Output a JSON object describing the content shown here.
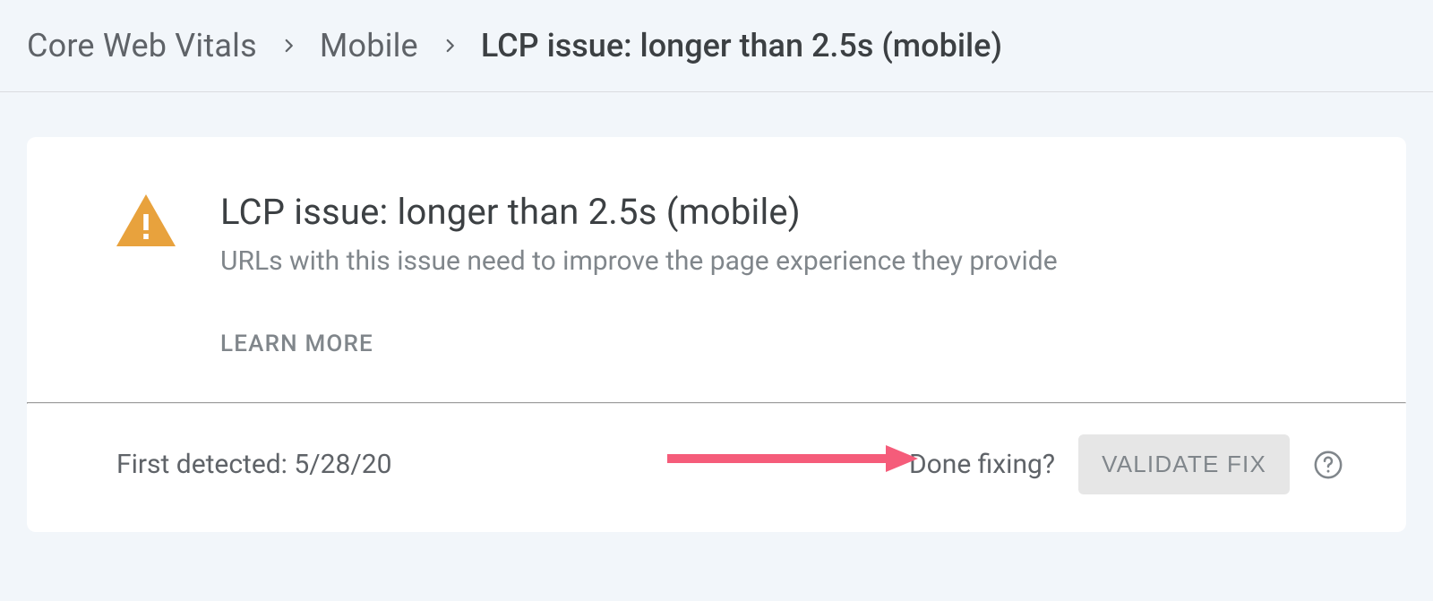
{
  "breadcrumb": {
    "items": [
      {
        "label": "Core Web Vitals",
        "current": false
      },
      {
        "label": "Mobile",
        "current": false
      },
      {
        "label": "LCP issue: longer than 2.5s (mobile)",
        "current": true
      }
    ]
  },
  "card": {
    "title": "LCP issue: longer than 2.5s (mobile)",
    "subtitle": "URLs with this issue need to improve the page experience they provide",
    "learn_more_label": "LEARN MORE",
    "warning_icon": "warning-triangle-icon"
  },
  "footer": {
    "first_detected_label": "First detected: 5/28/20",
    "done_fixing_label": "Done fixing?",
    "validate_button_label": "VALIDATE FIX",
    "help_icon": "help-circle-icon"
  },
  "annotation": {
    "arrow_color": "#f55c7a"
  }
}
